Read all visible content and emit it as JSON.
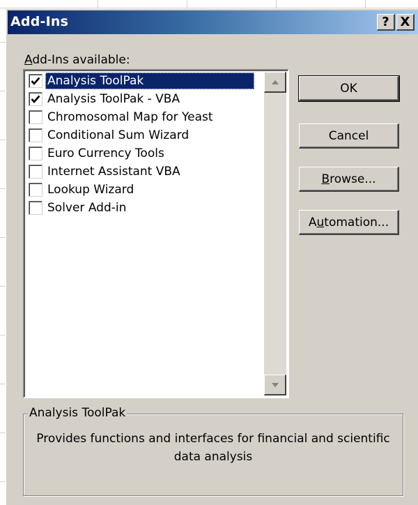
{
  "window": {
    "title": "Add-Ins",
    "help_label": "?",
    "close_label": "X"
  },
  "available_label": {
    "accesskey": "A",
    "rest": "dd-Ins available:"
  },
  "addins": [
    {
      "label": "Analysis ToolPak",
      "checked": true,
      "selected": true
    },
    {
      "label": "Analysis ToolPak - VBA",
      "checked": true,
      "selected": false
    },
    {
      "label": "Chromosomal Map for Yeast",
      "checked": false,
      "selected": false
    },
    {
      "label": "Conditional Sum Wizard",
      "checked": false,
      "selected": false
    },
    {
      "label": "Euro Currency Tools",
      "checked": false,
      "selected": false
    },
    {
      "label": "Internet Assistant VBA",
      "checked": false,
      "selected": false
    },
    {
      "label": "Lookup Wizard",
      "checked": false,
      "selected": false
    },
    {
      "label": "Solver Add-in",
      "checked": false,
      "selected": false
    }
  ],
  "buttons": {
    "ok": "OK",
    "cancel": "Cancel",
    "browse": {
      "accesskey": "B",
      "rest": "rowse..."
    },
    "automation": {
      "prefix": "A",
      "accesskey": "u",
      "rest": "tomation..."
    }
  },
  "description": {
    "title": "Analysis ToolPak",
    "text": "Provides functions and interfaces for financial and scientific data analysis"
  },
  "colors": {
    "title_bar_start": "#0a246a",
    "title_bar_end": "#a6caf0",
    "dialog_face": "#d4d0c8",
    "selection": "#0a246a"
  }
}
